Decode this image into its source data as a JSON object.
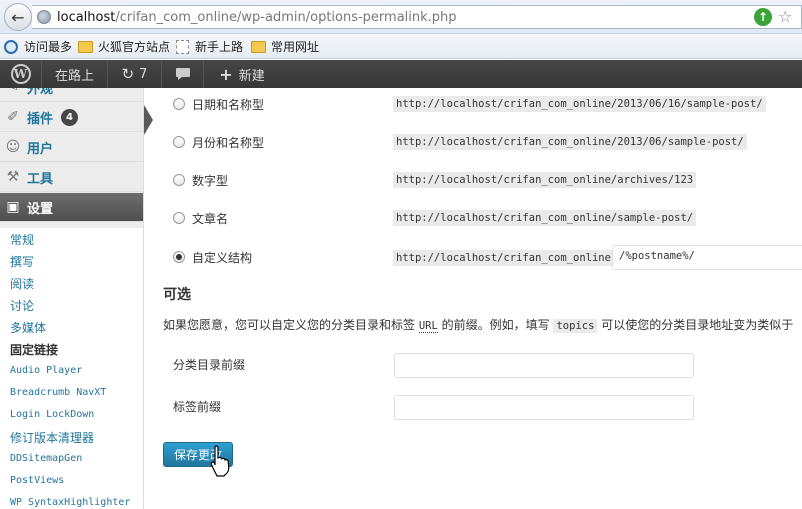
{
  "browser": {
    "url_host": "localhost",
    "url_path": "/crifan_com_online/wp-admin/options-permalink.php",
    "bookmarks": [
      "访问最多",
      "火狐官方站点",
      "新手上路",
      "常用网址"
    ]
  },
  "adminbar": {
    "site_name": "在路上",
    "updates_count": "7",
    "new_label": "新建"
  },
  "sidebar": {
    "menu": [
      {
        "label": "外观",
        "icon": "appearance-icon"
      },
      {
        "label": "插件",
        "icon": "plugins-icon",
        "badge": "4"
      },
      {
        "label": "用户",
        "icon": "users-icon"
      },
      {
        "label": "工具",
        "icon": "tools-icon"
      },
      {
        "label": "设置",
        "icon": "settings-icon"
      }
    ],
    "submenu": [
      "常规",
      "撰写",
      "阅读",
      "讨论",
      "多媒体",
      "固定链接",
      "Audio Player",
      "Breadcrumb NavXT",
      "Login LockDown",
      "修订版本清理器",
      "DDSitemapGen",
      "PostViews",
      "WP SyntaxHighlighter"
    ]
  },
  "permalink_options": [
    {
      "label": "日期和名称型",
      "example": "http://localhost/crifan_com_online/2013/06/16/sample-post/",
      "checked": false
    },
    {
      "label": "月份和名称型",
      "example": "http://localhost/crifan_com_online/2013/06/sample-post/",
      "checked": false
    },
    {
      "label": "数字型",
      "example": "http://localhost/crifan_com_online/archives/123",
      "checked": false
    },
    {
      "label": "文章名",
      "example": "http://localhost/crifan_com_online/sample-post/",
      "checked": false
    },
    {
      "label": "自定义结构",
      "example": "http://localhost/crifan_com_online",
      "checked": true,
      "value": "/%postname%/"
    }
  ],
  "optional": {
    "heading": "可选",
    "desc_before": "如果您愿意，您可以自定义您的分类目录和标签",
    "desc_abbr": "URL",
    "desc_middle": "的前缀。例如，填写",
    "desc_keyword": "topics",
    "desc_after": "可以使您的分类目录地址变为类似于",
    "category_base_label": "分类目录前缀",
    "tag_base_label": "标签前缀",
    "category_base_value": "",
    "tag_base_value": ""
  },
  "save_label": "保存更改"
}
